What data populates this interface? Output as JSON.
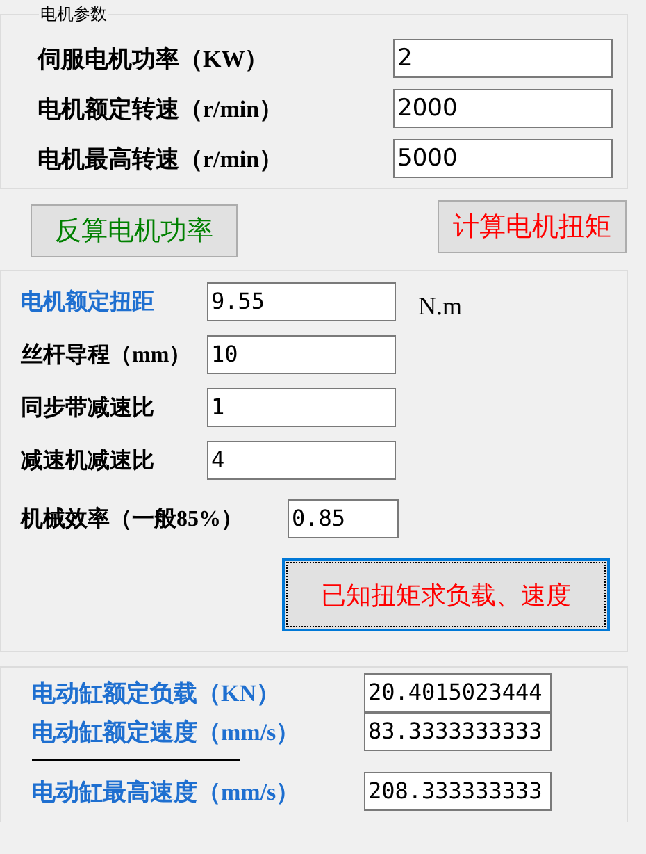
{
  "motor_group": {
    "title": "电机参数",
    "rows": [
      {
        "label": "伺服电机功率（KW）",
        "value": "2"
      },
      {
        "label": "电机额定转速（r/min）",
        "value": "2000"
      },
      {
        "label": "电机最高转速（r/min）",
        "value": "5000"
      }
    ]
  },
  "buttons": [
    {
      "label": "反算电机功率",
      "color": "#008000"
    },
    {
      "label": "计算电机扭矩",
      "color": "#ff0000"
    }
  ],
  "load_group": {
    "rows": [
      {
        "label": "电机额定扭距",
        "value": "9.55",
        "unit": "N.m",
        "color": "#1e6fd0"
      },
      {
        "label": "丝杆导程（mm）",
        "value": "10",
        "color": "#000000"
      },
      {
        "label": "同步带减速比",
        "value": "1",
        "color": "#000000"
      },
      {
        "label": "减速机减速比",
        "value": "4",
        "color": "#000000"
      },
      {
        "label": "机械效率（一般85%）",
        "value": "0.85",
        "color": "#000000"
      }
    ],
    "button": {
      "label": "已知扭矩求负载、速度",
      "color": "#ff0000",
      "focused": true
    }
  },
  "cylinder_group": {
    "rows": [
      {
        "label": "电动缸额定负载（KN）",
        "value": "20.4015023444"
      },
      {
        "label": "电动缸额定速度（mm/s）",
        "value": "83.3333333333"
      },
      {
        "label": "电动缸最高速度（mm/s）",
        "value": "208.333333333"
      }
    ]
  }
}
